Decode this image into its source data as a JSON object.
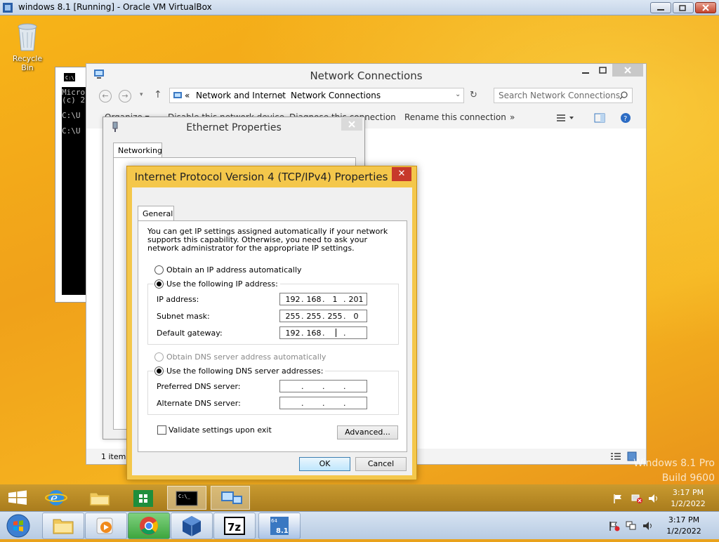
{
  "host": {
    "title": "windows 8.1 [Running] - Oracle VM VirtualBox",
    "clock_time": "3:17 PM",
    "clock_date": "1/2/2022",
    "taskbar_items": [
      "start-orb",
      "explorer",
      "media-player",
      "chrome",
      "virtualbox",
      "7zip",
      "windows-8.1-vm"
    ]
  },
  "desktop": {
    "recycle_bin_label": "Recycle Bin",
    "watermark_line1": "Windows 8.1 Pro",
    "watermark_line2": "Build 9600"
  },
  "cmd": {
    "lines": [
      "Micro",
      "(c) 2",
      "",
      "C:\\U",
      "",
      "C:\\U"
    ]
  },
  "explorer": {
    "title": "Network Connections",
    "address_prefix": "«",
    "breadcrumb_1": "Network and Internet",
    "breadcrumb_2": "Network Connections",
    "search_placeholder": "Search Network Connections",
    "cmd_organize": "Organize ▾",
    "cmd_disable": "Disable this network device",
    "cmd_diagnose": "Diagnose this connection",
    "cmd_rename": "Rename this connection",
    "cmd_more": "»",
    "status": "1 item"
  },
  "ethernet": {
    "title": "Ethernet Properties",
    "tab": "Networking"
  },
  "ipv4": {
    "title": "Internet Protocol Version 4 (TCP/IPv4) Properties",
    "tab": "General",
    "description": "You can get IP settings assigned automatically if your network supports this capability. Otherwise, you need to ask your network administrator for the appropriate IP settings.",
    "obtain_ip_auto": "Obtain an IP address automatically",
    "use_following_ip": "Use the following IP address:",
    "ip_label": "IP address:",
    "ip_value": [
      "192",
      "168",
      "1",
      "201"
    ],
    "subnet_label": "Subnet mask:",
    "subnet_value": [
      "255",
      "255",
      "255",
      "0"
    ],
    "gateway_label": "Default gateway:",
    "gateway_value": [
      "192",
      "168",
      "",
      ""
    ],
    "obtain_dns_auto": "Obtain DNS server address automatically",
    "use_following_dns": "Use the following DNS server addresses:",
    "preferred_dns_label": "Preferred DNS server:",
    "alternate_dns_label": "Alternate DNS server:",
    "validate_label": "Validate settings upon exit",
    "advanced_label": "Advanced...",
    "ok_label": "OK",
    "cancel_label": "Cancel"
  },
  "guest_tray": {
    "time": "3:17 PM",
    "date": "1/2/2022"
  }
}
